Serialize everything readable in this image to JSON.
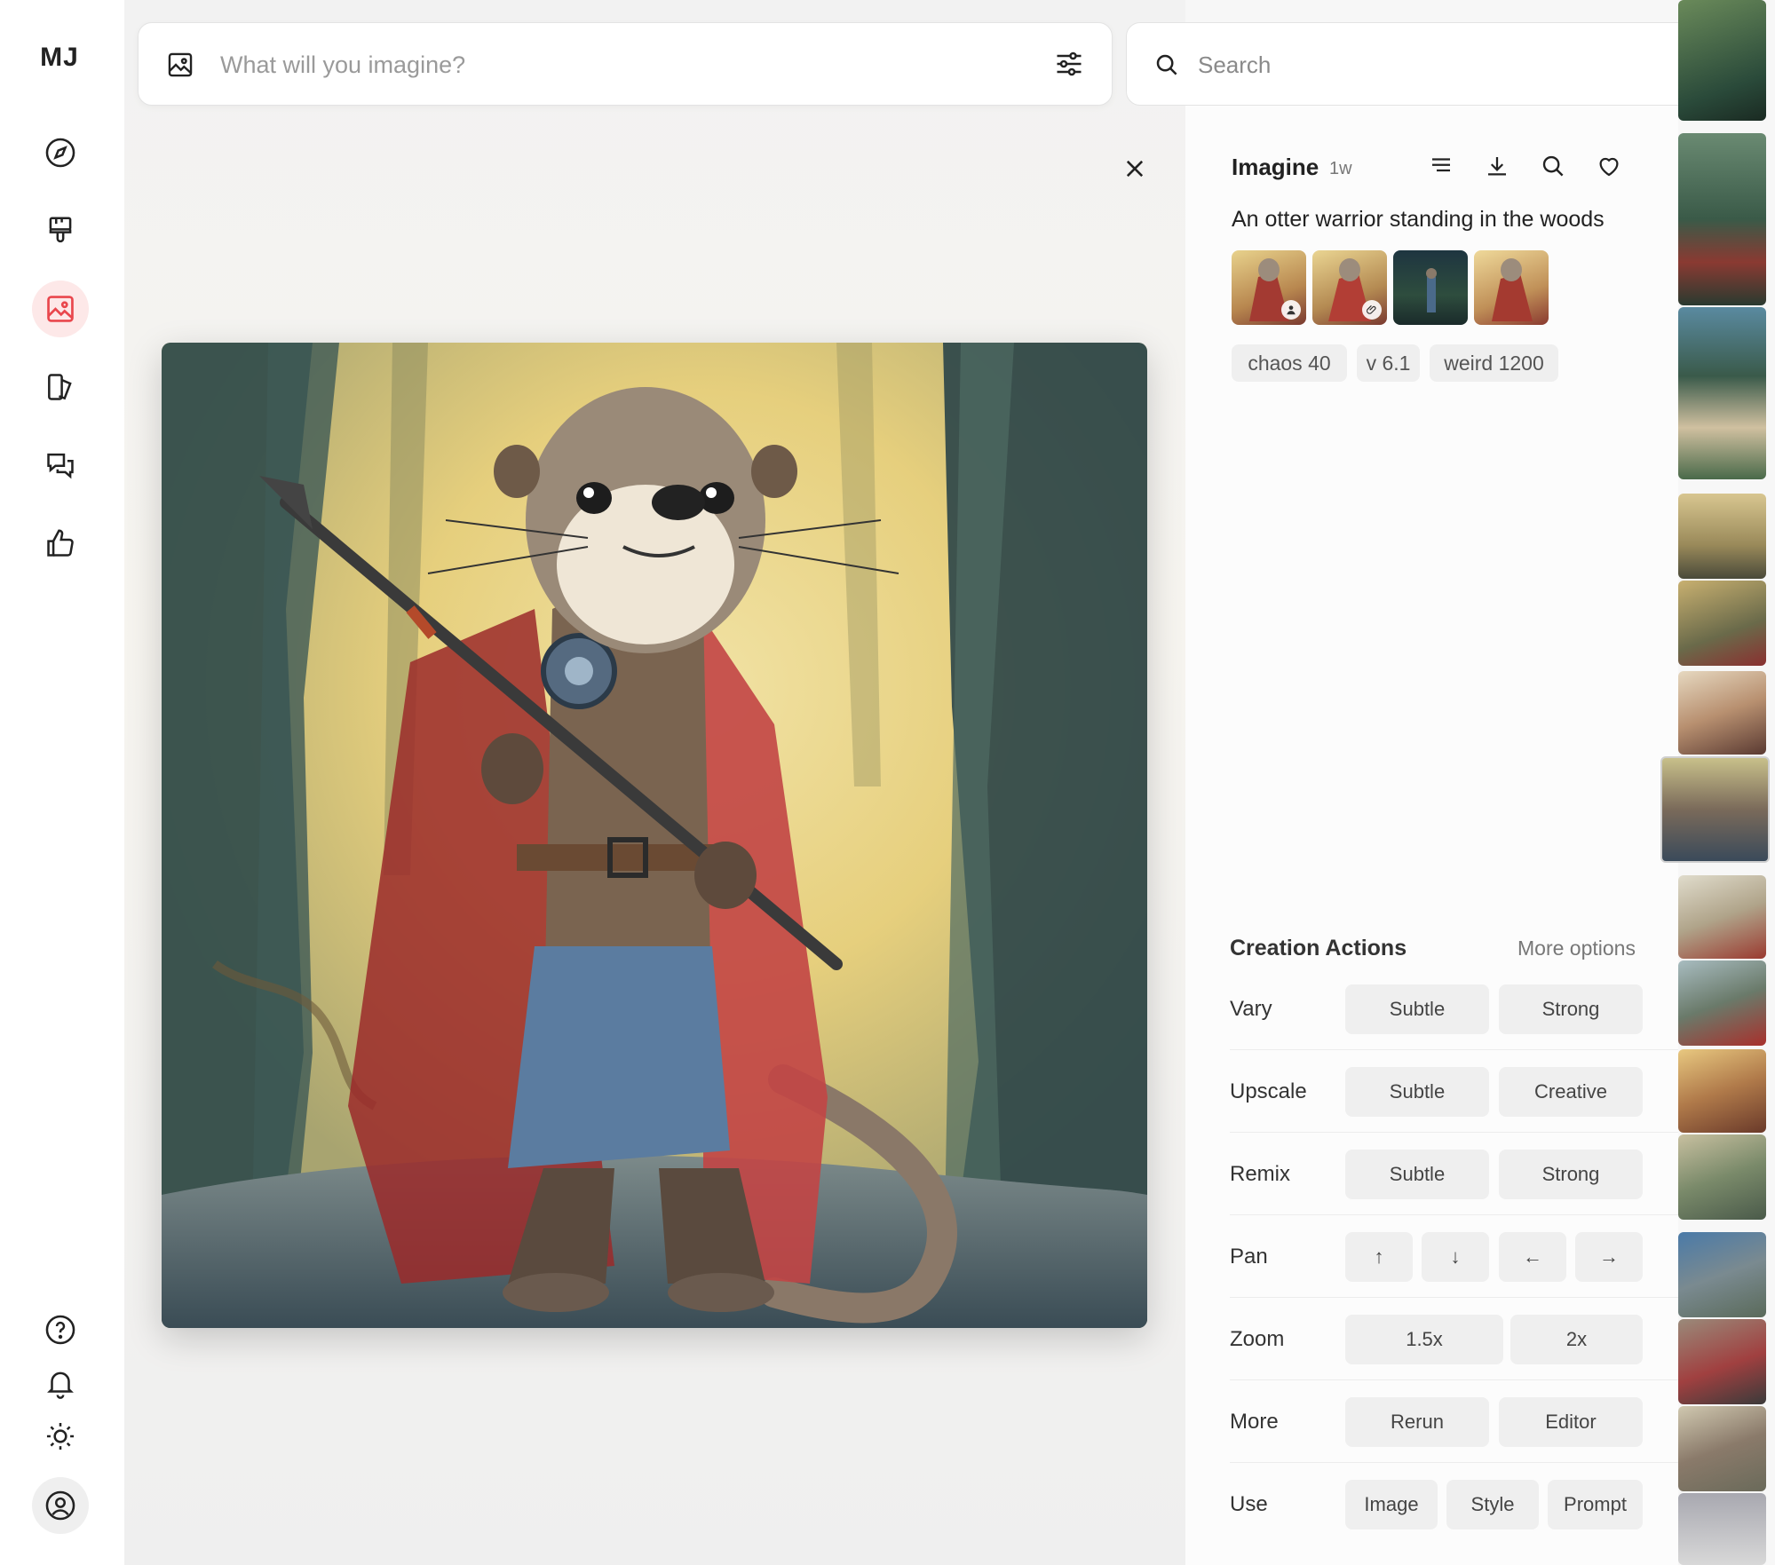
{
  "app": {
    "logo": "MJ"
  },
  "sidebar": {
    "items": [
      {
        "name": "explore",
        "icon": "compass-icon"
      },
      {
        "name": "edit",
        "icon": "paintbrush-icon"
      },
      {
        "name": "create",
        "icon": "image-icon",
        "active": true
      },
      {
        "name": "organize",
        "icon": "folders-icon"
      },
      {
        "name": "chat",
        "icon": "chat-bubbles-icon"
      },
      {
        "name": "tasks",
        "icon": "thumbs-up-icon"
      }
    ],
    "bottom": [
      "help-icon",
      "bell-icon",
      "sun-icon",
      "user-circle-icon"
    ],
    "active_color": "#e9474d"
  },
  "prompt_bar": {
    "placeholder": "What will you imagine?"
  },
  "search": {
    "placeholder": "Search"
  },
  "detail": {
    "title": "Imagine",
    "age": "1w",
    "prompt": "An otter warrior standing in the woods",
    "params": [
      "chaos 40",
      "v 6.1",
      "weird 1200"
    ]
  },
  "actions": {
    "title": "Creation Actions",
    "more_options": "More options",
    "rows": [
      {
        "label": "Vary",
        "buttons": [
          "Subtle",
          "Strong"
        ]
      },
      {
        "label": "Upscale",
        "buttons": [
          "Subtle",
          "Creative"
        ]
      },
      {
        "label": "Remix",
        "buttons": [
          "Subtle",
          "Strong"
        ]
      },
      {
        "label": "Pan",
        "buttons": [
          "↑",
          "↓",
          "←",
          "→"
        ]
      },
      {
        "label": "Zoom",
        "buttons": [
          "1.5x",
          "2x"
        ]
      },
      {
        "label": "More",
        "buttons": [
          "Rerun",
          "Editor"
        ]
      },
      {
        "label": "Use",
        "buttons": [
          "Image",
          "Style",
          "Prompt"
        ]
      }
    ]
  }
}
